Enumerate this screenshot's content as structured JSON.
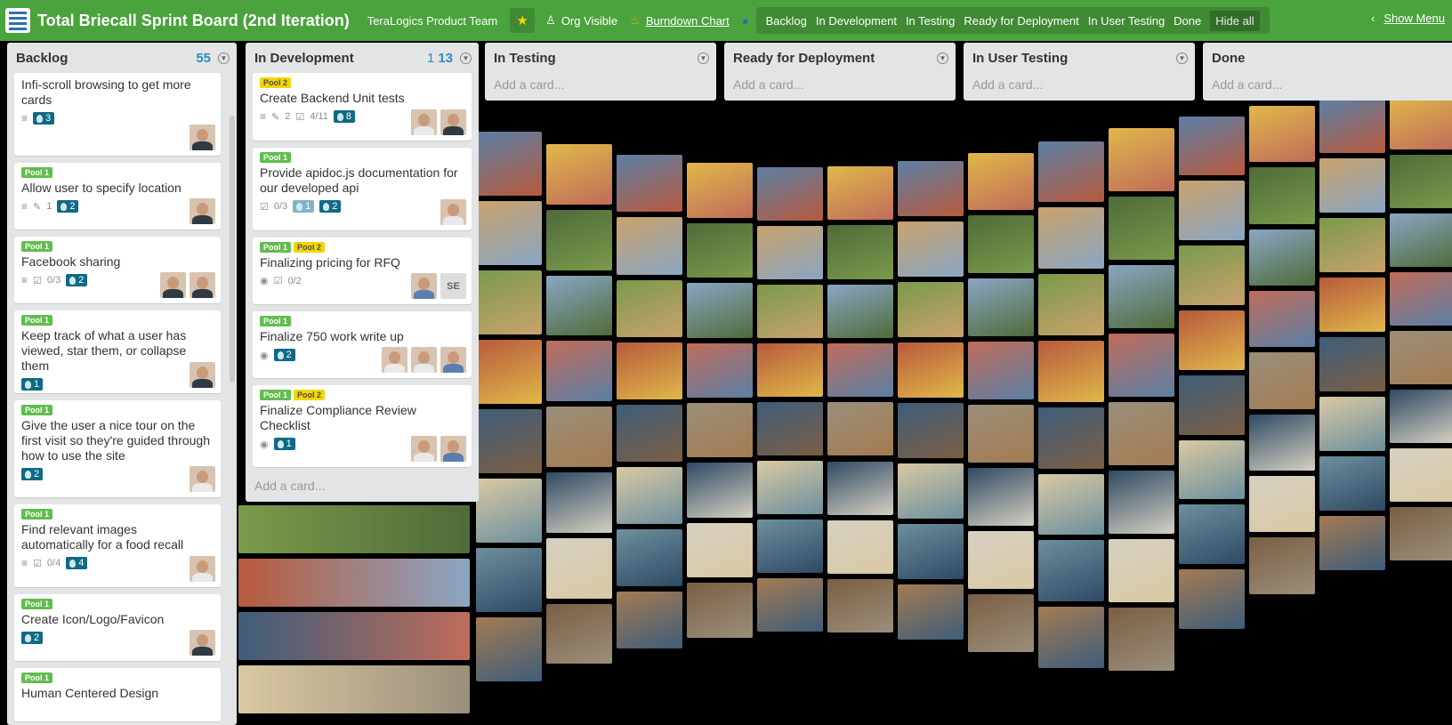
{
  "header": {
    "board_title": "Total Briecall Sprint Board (2nd Iteration)",
    "team": "TeraLogics Product Team",
    "visibility": "Org Visible",
    "burndown": "Burndown Chart",
    "filters": [
      "Backlog",
      "In Development",
      "In Testing",
      "Ready for Deployment",
      "In User Testing",
      "Done"
    ],
    "hide_all": "Hide all",
    "show_menu": "Show Menu"
  },
  "lists": {
    "backlog": {
      "title": "Backlog",
      "count": "55",
      "cards": [
        {
          "title": "Infi-scroll browsing to get more cards",
          "pill": "3"
        },
        {
          "label": "Pool 1",
          "title": "Allow user to specify location",
          "comments": "1",
          "pill": "2"
        },
        {
          "label": "Pool 1",
          "title": "Facebook sharing",
          "checklist": "0/3",
          "pill": "2"
        },
        {
          "label": "Pool 1",
          "title": "Keep track of what a user has viewed, star them, or collapse them",
          "pill": "1"
        },
        {
          "label": "Pool 1",
          "title": "Give the user a nice tour on the first visit so they're guided through how to use the site",
          "pill": "2"
        },
        {
          "label": "Pool 1",
          "title": "Find relevant images automatically for a food recall",
          "checklist": "0/4",
          "pill": "4"
        },
        {
          "label": "Pool 1",
          "title": "Create Icon/Logo/Favicon",
          "pill": "2"
        },
        {
          "label": "Pool 1",
          "title": "Human Centered Design"
        }
      ]
    },
    "in_development": {
      "title": "In Development",
      "count_sub": "1",
      "count": "13",
      "add_card": "Add a card...",
      "cards": [
        {
          "label": "Pool 2",
          "title": "Create Backend Unit tests",
          "comments": "2",
          "checklist": "4/11",
          "pill": "8"
        },
        {
          "label": "Pool 1",
          "title": "Provide apidoc.js documentation for our developed api",
          "checklist": "0/3",
          "pill_light": "1",
          "pill": "2"
        },
        {
          "label": "Pool 1",
          "label2": "Pool 2",
          "title": "Finalizing pricing for RFQ",
          "checklist": "0/2",
          "initials": "SE"
        },
        {
          "label": "Pool 1",
          "title": "Finalize 750 work write up",
          "pill": "2"
        },
        {
          "label": "Pool 1",
          "label2": "Pool 2",
          "title": "Finalize Compliance Review Checklist",
          "pill": "1"
        }
      ]
    },
    "in_testing": {
      "title": "In Testing",
      "add_card": "Add a card..."
    },
    "ready": {
      "title": "Ready for Deployment",
      "add_card": "Add a card..."
    },
    "user_testing": {
      "title": "In User Testing",
      "add_card": "Add a card..."
    },
    "done": {
      "title": "Done",
      "add_card": "Add a card..."
    }
  },
  "icons": {
    "description": "description-icon",
    "comment": "comment-icon",
    "checklist": "checklist-icon",
    "watch": "eye-icon",
    "points": "points-badge-icon"
  },
  "colors": {
    "header": "#4aa33c",
    "label_green": "#61bd4f",
    "label_yellow": "#f2d600",
    "pill": "#0e6a85",
    "list_bg": "#e2e4e6"
  }
}
